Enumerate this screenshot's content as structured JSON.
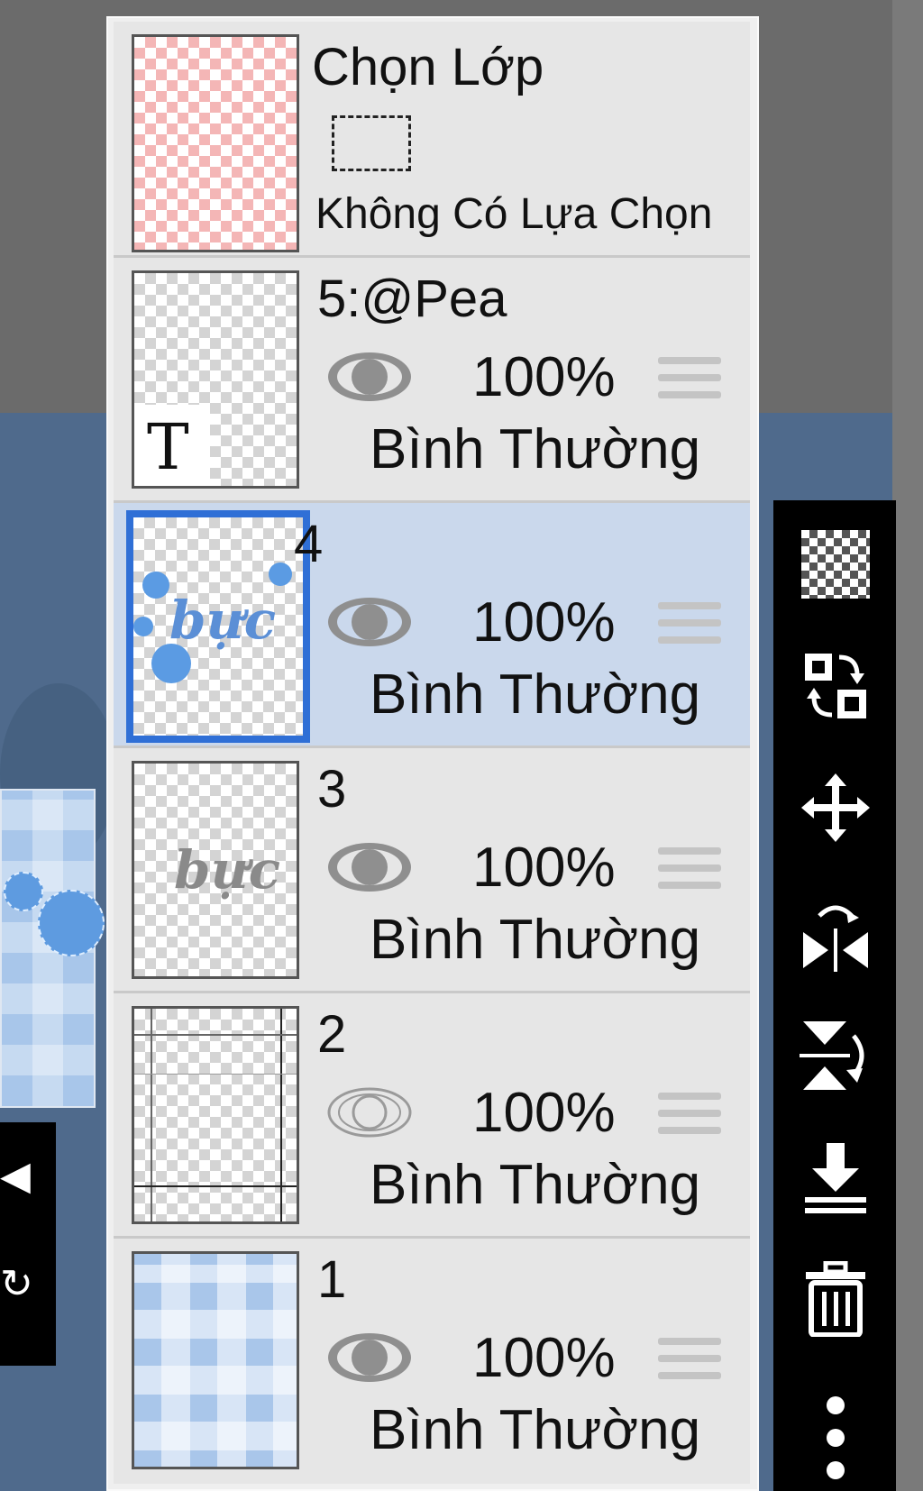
{
  "selection_row": {
    "title": "Chọn Lớp",
    "status": "Không Có Lựa Chọn"
  },
  "layers": [
    {
      "name": "5:@Pea",
      "opacity": "100%",
      "blend": "Bình Thường",
      "visible": true,
      "selected": false,
      "thumb_glyph": "T"
    },
    {
      "name": "4",
      "opacity": "100%",
      "blend": "Bình Thường",
      "visible": true,
      "selected": true,
      "thumb_text": "bực"
    },
    {
      "name": "3",
      "opacity": "100%",
      "blend": "Bình Thường",
      "visible": true,
      "selected": false,
      "thumb_text": "bực"
    },
    {
      "name": "2",
      "opacity": "100%",
      "blend": "Bình Thường",
      "visible": false,
      "selected": false
    },
    {
      "name": "1",
      "opacity": "100%",
      "blend": "Bình Thường",
      "visible": true,
      "selected": false
    }
  ],
  "toolbar": {
    "tools": [
      "transparency-checker-icon",
      "swap-layers-icon",
      "move-icon",
      "flip-horizontal-icon",
      "flip-vertical-icon",
      "merge-down-icon",
      "trash-icon",
      "more-vertical-icon"
    ]
  },
  "colors": {
    "selected_row": "#cad8ec",
    "selected_border": "#2f6fd6",
    "toolbar_bg": "#000000",
    "panel_bg": "#e6e6e6"
  }
}
